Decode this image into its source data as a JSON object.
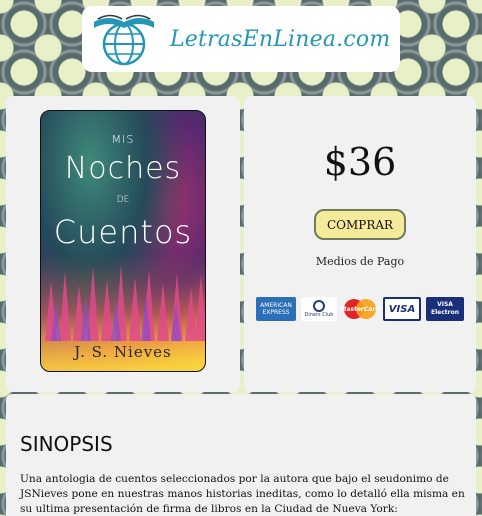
{
  "header": {
    "logo_text": "LetrasEnLinea.com",
    "logo_icon": "book-globe-icon",
    "brand_color": "#2496b8"
  },
  "book": {
    "cover_title_mis": "MIS",
    "cover_title_noches": "Noches",
    "cover_title_de": "DE",
    "cover_title_cuentos": "Cuentos",
    "cover_author": "J. S. Nieves"
  },
  "purchase": {
    "price": "$36",
    "buy_label": "COMPRAR",
    "payment_label": "Medios de Pago",
    "payment_methods": {
      "amex_line1": "AMERICAN",
      "amex_line2": "EXPRESS",
      "diners": "Diners Club",
      "mastercard": "MasterCard",
      "visa": "VISA",
      "visa_electron_line1": "VISA",
      "visa_electron_line2": "Electron"
    },
    "button_color": "#f5e99a"
  },
  "synopsis": {
    "title": "SINOPSIS",
    "text": "Una antologia de cuentos seleccionados por la autora que bajo el seudonimo de JSNieves pone en nuestras manos historias ineditas, como lo detalló ella misma en su ultima presentación de firma de libros en la Ciudad de Nueva York:"
  }
}
